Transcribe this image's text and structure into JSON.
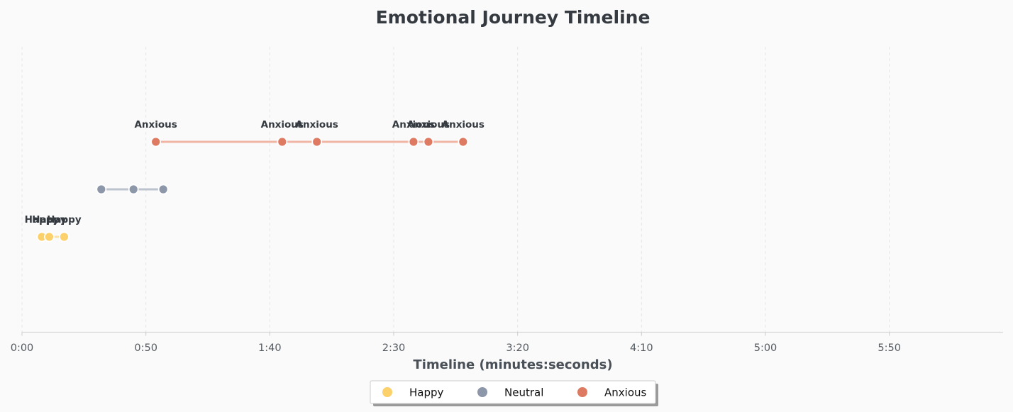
{
  "chart_data": {
    "type": "scatter",
    "title": "Emotional Journey Timeline",
    "xlabel": "Timeline (minutes:seconds)",
    "ylabel": "",
    "xlim": [
      0,
      400
    ],
    "x_ticks": [
      {
        "value": 0,
        "label": "0:00"
      },
      {
        "value": 50,
        "label": "0:50"
      },
      {
        "value": 100,
        "label": "1:40"
      },
      {
        "value": 150,
        "label": "2:30"
      },
      {
        "value": 200,
        "label": "3:20"
      },
      {
        "value": 250,
        "label": "4:10"
      },
      {
        "value": 300,
        "label": "5:00"
      },
      {
        "value": 350,
        "label": "5:50"
      }
    ],
    "grid": "vertical dashed",
    "legend_position": "bottom-center",
    "series": [
      {
        "name": "Happy",
        "color": "#fcd06b",
        "line_color": "#fbe3a6",
        "level": 1,
        "points": [
          {
            "x": 8,
            "label": "Happy"
          },
          {
            "x": 11,
            "label": "Happy"
          },
          {
            "x": 17,
            "label": "Happy"
          }
        ]
      },
      {
        "name": "Neutral",
        "color": "#8d97aa",
        "line_color": "#bcc3cd",
        "level": 2,
        "points": [
          {
            "x": 32,
            "label": ""
          },
          {
            "x": 45,
            "label": ""
          },
          {
            "x": 57,
            "label": ""
          }
        ]
      },
      {
        "name": "Anxious",
        "color": "#de7a62",
        "line_color": "#f0b5a5",
        "level": 3,
        "points": [
          {
            "x": 54,
            "label": "Anxious"
          },
          {
            "x": 105,
            "label": "Anxious"
          },
          {
            "x": 119,
            "label": "Anxious"
          },
          {
            "x": 158,
            "label": "Anxious"
          },
          {
            "x": 164,
            "label": "Anxious"
          },
          {
            "x": 178,
            "label": "Anxious"
          }
        ]
      }
    ]
  }
}
